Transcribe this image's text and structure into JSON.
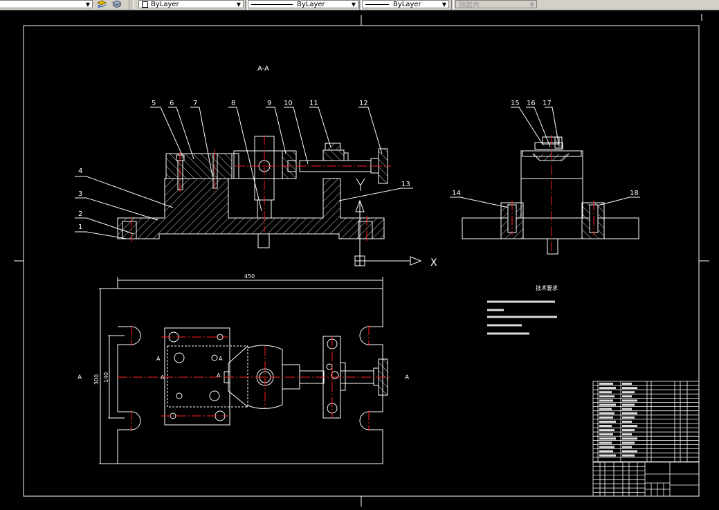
{
  "toolbar": {
    "layer_dropdown_arrow": "▼",
    "color_value": "ByLayer",
    "linetype_value": "ByLayer",
    "lineweight_value": "ByLayer",
    "plotstyle_value": "随颜色",
    "icons": [
      "layer-previous-icon",
      "layer-states-icon"
    ]
  },
  "colors": {
    "background": "#000000",
    "geometry": "#ffffff",
    "centerline": "#ff0000",
    "toolbar": "#d4d0c8"
  },
  "drawing": {
    "section_title": "A-A",
    "part_numbers_front": [
      "1",
      "2",
      "3",
      "4",
      "5",
      "6",
      "7",
      "8",
      "9",
      "10",
      "11",
      "12",
      "13"
    ],
    "part_numbers_side": [
      "14",
      "15",
      "16",
      "17",
      "18"
    ],
    "dimension_450": "450",
    "dimension_300": "300",
    "dimension_140": "140",
    "section_mark": "A",
    "ucs_x": "X",
    "ucs_y": "Y",
    "tech_requirements_title": "技术要求"
  }
}
